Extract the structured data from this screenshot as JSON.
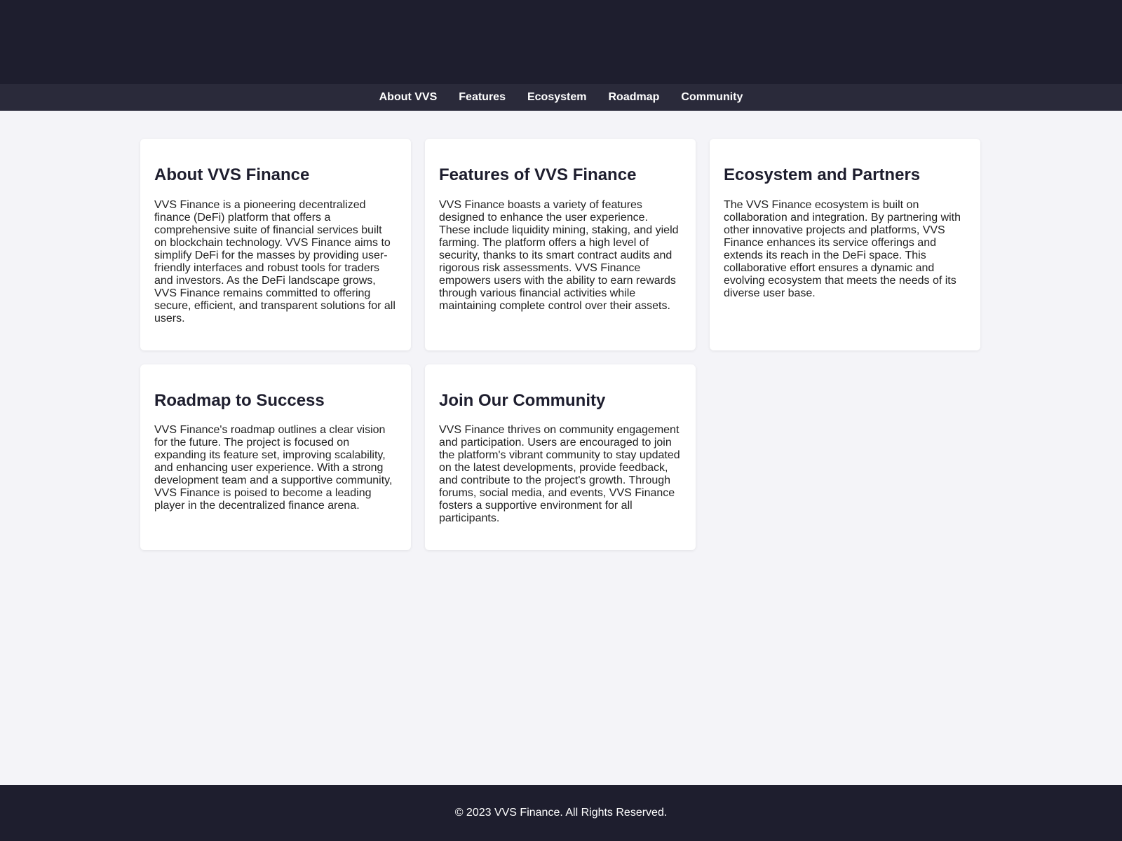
{
  "colors": {
    "header_bg": "#1e1e2e",
    "nav_bg": "#2a2a3a",
    "page_bg": "#f4f4f8",
    "card_bg": "#ffffff",
    "footer_bg": "#1e1e2e"
  },
  "nav": {
    "items": [
      {
        "label": "About VVS"
      },
      {
        "label": "Features"
      },
      {
        "label": "Ecosystem"
      },
      {
        "label": "Roadmap"
      },
      {
        "label": "Community"
      }
    ]
  },
  "cards": [
    {
      "title": "About VVS Finance",
      "body": "VVS Finance is a pioneering decentralized finance (DeFi) platform that offers a comprehensive suite of financial services built on blockchain technology. VVS Finance aims to simplify DeFi for the masses by providing user-friendly interfaces and robust tools for traders and investors. As the DeFi landscape grows, VVS Finance remains committed to offering secure, efficient, and transparent solutions for all users."
    },
    {
      "title": "Features of VVS Finance",
      "body": "VVS Finance boasts a variety of features designed to enhance the user experience. These include liquidity mining, staking, and yield farming. The platform offers a high level of security, thanks to its smart contract audits and rigorous risk assessments. VVS Finance empowers users with the ability to earn rewards through various financial activities while maintaining complete control over their assets."
    },
    {
      "title": "Ecosystem and Partners",
      "body": "The VVS Finance ecosystem is built on collaboration and integration. By partnering with other innovative projects and platforms, VVS Finance enhances its service offerings and extends its reach in the DeFi space. This collaborative effort ensures a dynamic and evolving ecosystem that meets the needs of its diverse user base."
    },
    {
      "title": "Roadmap to Success",
      "body": "VVS Finance's roadmap outlines a clear vision for the future. The project is focused on expanding its feature set, improving scalability, and enhancing user experience. With a strong development team and a supportive community, VVS Finance is poised to become a leading player in the decentralized finance arena."
    },
    {
      "title": "Join Our Community",
      "body": "VVS Finance thrives on community engagement and participation. Users are encouraged to join the platform's vibrant community to stay updated on the latest developments, provide feedback, and contribute to the project's growth. Through forums, social media, and events, VVS Finance fosters a supportive environment for all participants."
    }
  ],
  "footer": {
    "text": "© 2023 VVS Finance. All Rights Reserved."
  }
}
